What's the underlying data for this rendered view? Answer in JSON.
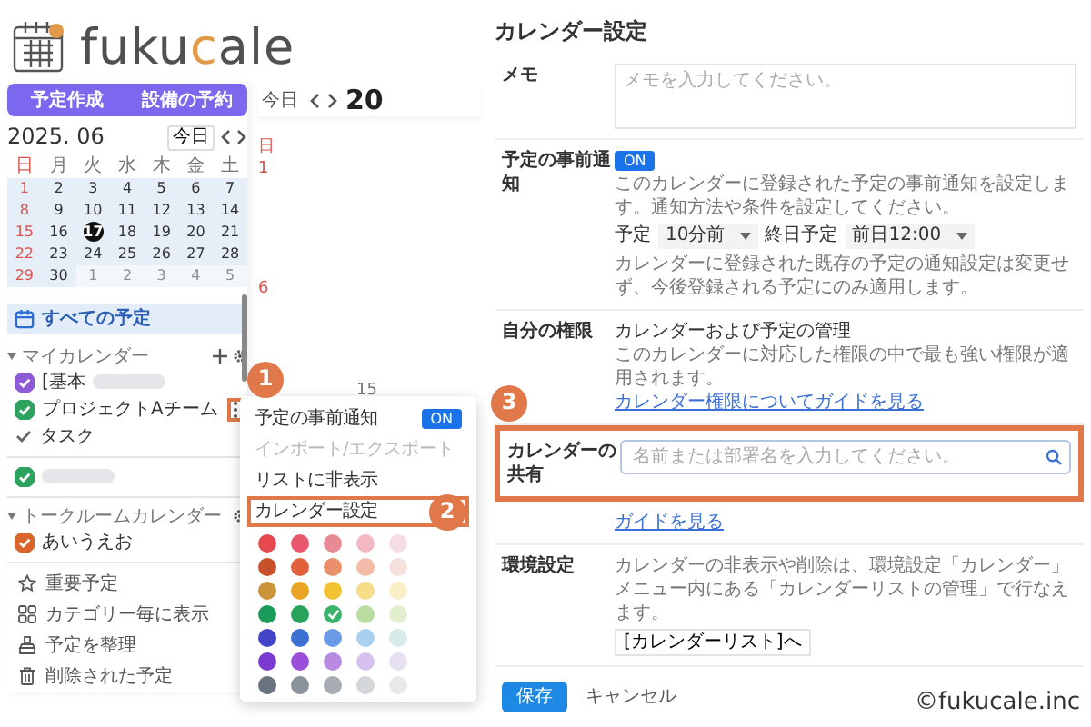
{
  "logo": {
    "parts": [
      {
        "text": "fuku",
        "accent": false
      },
      {
        "text": "c",
        "accent": true
      },
      {
        "text": "ale",
        "accent": false
      }
    ]
  },
  "sidebar": {
    "buttons": [
      "予定作成",
      "設備の予約"
    ],
    "mini_calendar": {
      "title": "2025. 06",
      "today_button": "今日",
      "weekdays": [
        "日",
        "月",
        "火",
        "水",
        "木",
        "金",
        "土"
      ],
      "weeks": [
        [
          {
            "day": "1",
            "muted": false,
            "today": false
          },
          {
            "day": "2",
            "muted": false,
            "today": false
          },
          {
            "day": "3",
            "muted": false,
            "today": false
          },
          {
            "day": "4",
            "muted": false,
            "today": false
          },
          {
            "day": "5",
            "muted": false,
            "today": false
          },
          {
            "day": "6",
            "muted": false,
            "today": false
          },
          {
            "day": "7",
            "muted": false,
            "today": false
          }
        ],
        [
          {
            "day": "8",
            "muted": false,
            "today": false
          },
          {
            "day": "9",
            "muted": false,
            "today": false
          },
          {
            "day": "10",
            "muted": false,
            "today": false
          },
          {
            "day": "11",
            "muted": false,
            "today": false
          },
          {
            "day": "12",
            "muted": false,
            "today": false
          },
          {
            "day": "13",
            "muted": false,
            "today": false
          },
          {
            "day": "14",
            "muted": false,
            "today": false
          }
        ],
        [
          {
            "day": "15",
            "muted": false,
            "today": false
          },
          {
            "day": "16",
            "muted": false,
            "today": false
          },
          {
            "day": "17",
            "muted": false,
            "today": true
          },
          {
            "day": "18",
            "muted": false,
            "today": false
          },
          {
            "day": "19",
            "muted": false,
            "today": false
          },
          {
            "day": "20",
            "muted": false,
            "today": false
          },
          {
            "day": "21",
            "muted": false,
            "today": false
          }
        ],
        [
          {
            "day": "22",
            "muted": false,
            "today": false
          },
          {
            "day": "23",
            "muted": false,
            "today": false
          },
          {
            "day": "24",
            "muted": false,
            "today": false
          },
          {
            "day": "25",
            "muted": false,
            "today": false
          },
          {
            "day": "26",
            "muted": false,
            "today": false
          },
          {
            "day": "27",
            "muted": false,
            "today": false
          },
          {
            "day": "28",
            "muted": false,
            "today": false
          }
        ],
        [
          {
            "day": "29",
            "muted": false,
            "today": false
          },
          {
            "day": "30",
            "muted": false,
            "today": false
          },
          {
            "day": "1",
            "muted": true,
            "today": false
          },
          {
            "day": "2",
            "muted": true,
            "today": false
          },
          {
            "day": "3",
            "muted": true,
            "today": false
          },
          {
            "day": "4",
            "muted": true,
            "today": false
          },
          {
            "day": "5",
            "muted": true,
            "today": false
          }
        ]
      ]
    },
    "all_events": {
      "label": "すべての予定",
      "selected": true
    },
    "groups": [
      {
        "title": "マイカレンダー",
        "can_add": true,
        "calendars": [
          {
            "kind": "calendar",
            "name": "[基本",
            "redacted": true,
            "color": "#8e5bd6",
            "checked": true,
            "menu_open": false
          },
          {
            "kind": "calendar",
            "name": "プロジェクトAチーム",
            "redacted": false,
            "color": "#2ea35f",
            "checked": true,
            "menu_open": true
          },
          {
            "kind": "task",
            "name": "タスク",
            "redacted": false,
            "checked": true,
            "menu_open": false
          }
        ]
      },
      {
        "calendars": [
          {
            "kind": "calendar",
            "redacted": true,
            "color": "#2ea35f",
            "checked": true,
            "menu_open": false
          }
        ]
      },
      {
        "title": "トークルームカレンダー",
        "can_add": false,
        "calendars": [
          {
            "kind": "calendar",
            "name": "あいうえお",
            "redacted": false,
            "color": "#d9652b",
            "checked": true,
            "menu_open": false
          }
        ]
      }
    ],
    "shortcuts": [
      {
        "label": "重要予定"
      },
      {
        "label": "カテゴリー毎に表示"
      },
      {
        "label": "予定を整理"
      },
      {
        "label": "削除された予定"
      }
    ]
  },
  "main": {
    "today_button": "今日",
    "date": "20",
    "cells": [
      {
        "text": "日",
        "sunday": true
      },
      {
        "text": "1",
        "sunday": true
      },
      {
        "text": "6",
        "sunday": true
      },
      {
        "text": "15",
        "sunday": false
      }
    ]
  },
  "popup_menu": {
    "items": [
      {
        "kind": "toggle",
        "label": "予定の事前通知",
        "on": true,
        "toggle_text": "ON",
        "disabled": false
      },
      {
        "kind": "item",
        "label": "インポート/エクスポート",
        "disabled": true
      },
      {
        "kind": "item",
        "label": "リストに非表示",
        "disabled": false
      },
      {
        "kind": "item",
        "label": "カレンダー設定",
        "disabled": false
      }
    ],
    "colors": [
      [
        {
          "color": "#e5484d",
          "selected": false
        },
        {
          "color": "#e8576b",
          "selected": false
        },
        {
          "color": "#e88a93",
          "selected": false
        },
        {
          "color": "#f3b8c4",
          "selected": false
        },
        {
          "color": "#f6dde3",
          "selected": false
        }
      ],
      [
        {
          "color": "#c8502a",
          "selected": false
        },
        {
          "color": "#e4603c",
          "selected": false
        },
        {
          "color": "#e9906a",
          "selected": false
        },
        {
          "color": "#f2bca8",
          "selected": false
        },
        {
          "color": "#f6e0dc",
          "selected": false
        }
      ],
      [
        {
          "color": "#c9943a",
          "selected": false
        },
        {
          "color": "#e9a424",
          "selected": false
        },
        {
          "color": "#f1c232",
          "selected": false
        },
        {
          "color": "#f7dc8a",
          "selected": false
        },
        {
          "color": "#faefc6",
          "selected": false
        }
      ],
      [
        {
          "color": "#1a9b5a",
          "selected": false
        },
        {
          "color": "#27a35c",
          "selected": false
        },
        {
          "color": "#3bb36b",
          "selected": true
        },
        {
          "color": "#b9dca0",
          "selected": false
        },
        {
          "color": "#e1efcf",
          "selected": false
        }
      ],
      [
        {
          "color": "#4343c8",
          "selected": false
        },
        {
          "color": "#3b6fd4",
          "selected": false
        },
        {
          "color": "#6b9be8",
          "selected": false
        },
        {
          "color": "#a9d0ee",
          "selected": false
        },
        {
          "color": "#d7eaea",
          "selected": false
        }
      ],
      [
        {
          "color": "#7b3bd0",
          "selected": false
        },
        {
          "color": "#9b4fd8",
          "selected": false
        },
        {
          "color": "#b88be0",
          "selected": false
        },
        {
          "color": "#d6c2ee",
          "selected": false
        },
        {
          "color": "#e6e0f0",
          "selected": false
        }
      ],
      [
        {
          "color": "#6a7280",
          "selected": false
        },
        {
          "color": "#8b929c",
          "selected": false
        },
        {
          "color": "#a6abb2",
          "selected": false
        },
        {
          "color": "#d4d6d9",
          "selected": false
        },
        {
          "color": "#e8e9eb",
          "selected": false
        }
      ]
    ]
  },
  "settings": {
    "title": "カレンダー設定",
    "rows": [
      {
        "kind": "textarea",
        "label": "メモ",
        "placeholder": "メモを入力してください。"
      },
      {
        "kind": "notification",
        "label": "予定の事前通知",
        "toggle": {
          "on": true,
          "text": "ON"
        },
        "description": "このカレンダーに登録された予定の事前通知を設定します。通知方法や条件を設定してください。",
        "selects": [
          {
            "label": "予定",
            "value": "10分前"
          },
          {
            "label": "終日予定",
            "value": "前日12:00"
          }
        ],
        "note": "カレンダーに登録された既存の予定の通知設定は変更せず、今後登録される予定にのみ適用します。"
      },
      {
        "kind": "permission",
        "label": "自分の権限",
        "heading": "カレンダーおよび予定の管理",
        "description": "このカレンダーに対応した権限の中で最も強い権限が適用されます。",
        "link": "カレンダー権限についてガイドを見る"
      },
      {
        "kind": "share",
        "label": "カレンダーの共有",
        "placeholder": "名前または部署名を入力してください。",
        "link": "ガイドを見る"
      },
      {
        "kind": "info",
        "label": "環境設定",
        "description": "カレンダーの非表示や削除は、環境設定「カレンダー」メニュー内にある「カレンダーリストの管理」で行なえます。",
        "button": "[カレンダーリスト]へ"
      }
    ],
    "actions": [
      {
        "kind": "primary",
        "label": "保存"
      },
      {
        "kind": "plain",
        "label": "キャンセル"
      }
    ]
  },
  "annotations": [
    {
      "label": "1"
    },
    {
      "label": "2"
    },
    {
      "label": "3"
    }
  ],
  "copyright": "©fukucale.inc"
}
